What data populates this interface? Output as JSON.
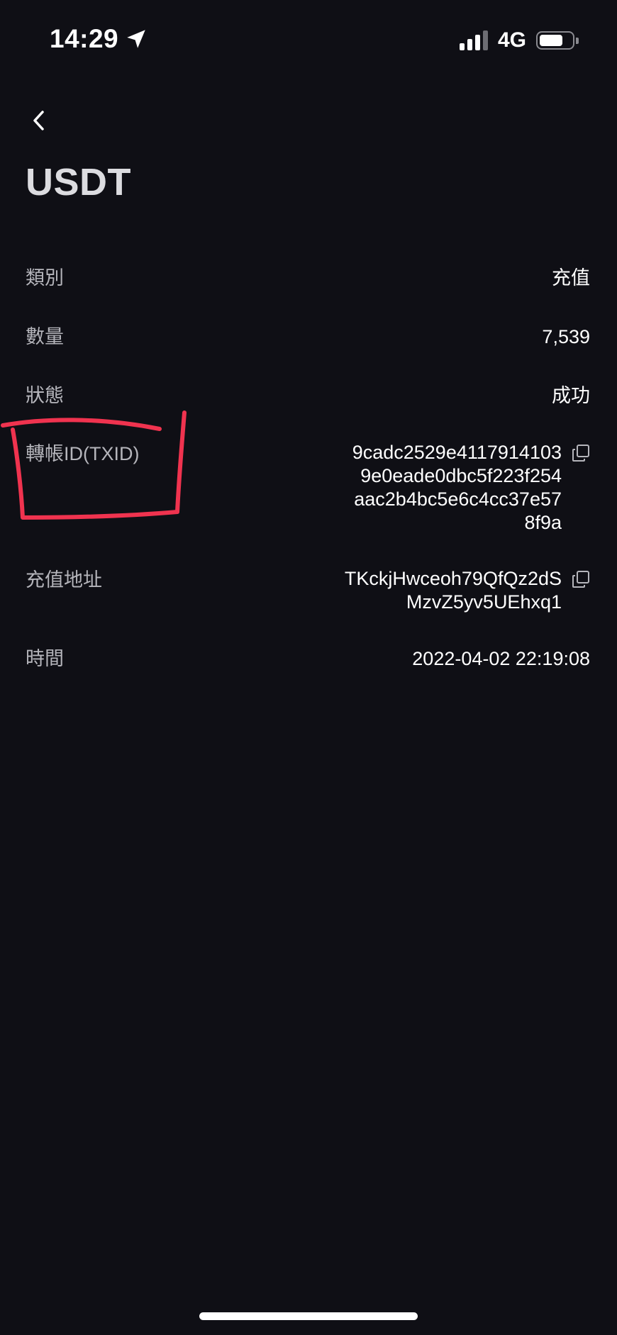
{
  "status_bar": {
    "time": "14:29",
    "network": "4G",
    "battery_level": 0.75,
    "signal_bars": 3
  },
  "header": {
    "back_icon": "chevron-left-icon",
    "title": "USDT"
  },
  "details": [
    {
      "label": "類別",
      "value": "充值"
    },
    {
      "label": "數量",
      "value": "7,539"
    },
    {
      "label": "狀態",
      "value": "成功"
    },
    {
      "label": "轉帳ID(TXID)",
      "value_lines": [
        "9cadc2529e4117914103",
        "9e0eade0dbc5f223f254",
        "aac2b4bc5e6c4cc37e57",
        "8f9a"
      ],
      "copy_icon": "copy-icon"
    },
    {
      "label": "充值地址",
      "value_lines": [
        "TKckjHwceoh79QfQz2dS",
        "MzvZ5yv5UEhxq1"
      ],
      "copy_icon": "copy-icon"
    },
    {
      "label": "時間",
      "value": "2022-04-02 22:19:08"
    }
  ],
  "colors": {
    "background": "#0f0f15",
    "label_text": "#b5b5bb",
    "value_text": "#ffffff",
    "annotation": "#f0334f"
  }
}
